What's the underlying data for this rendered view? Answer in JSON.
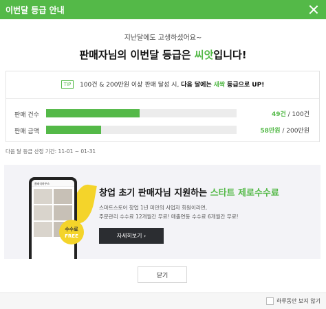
{
  "header": {
    "title": "이번달 등급 안내"
  },
  "greeting": "지난달에도 고생하셨어요~",
  "headline": {
    "prefix": "판매자님의 이번달 등급은 ",
    "grade": "씨앗",
    "suffix": "입니다!"
  },
  "tip": {
    "badge": "TIP",
    "text": "100건 & 200만원 이상 판매 달성 시,",
    "bold": "다음 달에는",
    "next_grade": "새싹",
    "bold_suffix": "등급으로 UP!"
  },
  "metrics": [
    {
      "label": "판매 건수",
      "current": "49건",
      "separator": " / ",
      "target": "100건",
      "progress": 0.49
    },
    {
      "label": "판매 금액",
      "current": "58만원",
      "separator": " / ",
      "target": "200만원",
      "progress": 0.29
    }
  ],
  "period": "다음 달 등급 산정 기간: 11-01 ~ 01-31",
  "promo": {
    "title_prefix": "창업 초기 판매자님 지원하는 ",
    "title_highlight": "스타트 제로수수료",
    "desc_line1": "스마트스토어 창업 1년 미만의 사업자 회원이라면,",
    "desc_line2": "주문관리 수수료 12개월간 무료! 매출연동 수수료 6개월간 무료!",
    "button_label": "자세히보기 ›",
    "phone_title": "클래식하우스",
    "phone_badge_line1": "수수료",
    "phone_badge_line2": "FREE",
    "accent_color": "#f4d42a"
  },
  "close_label": "닫기",
  "footer": {
    "hide_today_label": "하루동안 보지 않기"
  },
  "colors": {
    "brand": "#54b948",
    "dark_button": "#2b2d31"
  }
}
